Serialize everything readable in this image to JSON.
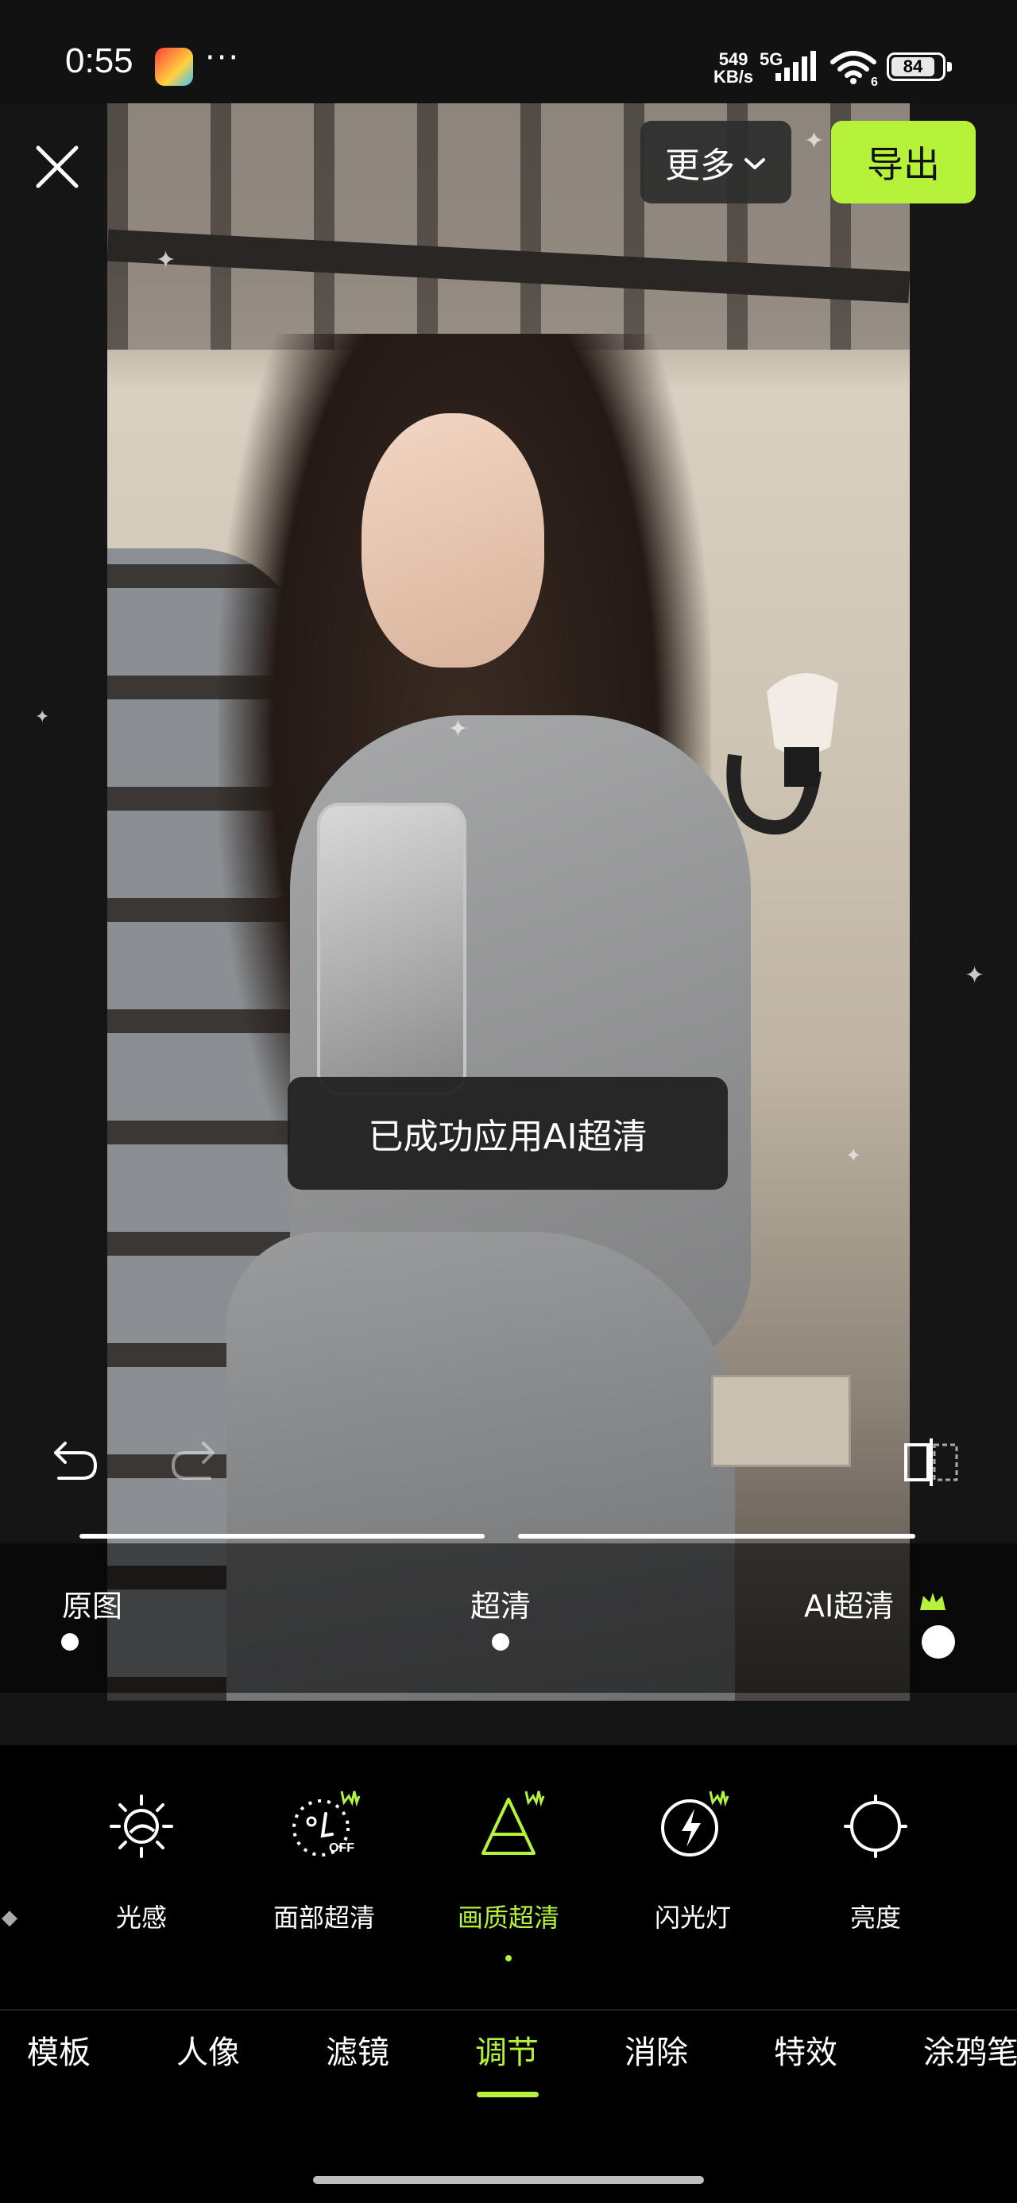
{
  "status_bar": {
    "time": "0:55",
    "overflow": "···",
    "net_speed_value": "549",
    "net_speed_unit": "KB/s",
    "network": "5G",
    "wifi_badge": "6",
    "battery": "84"
  },
  "top_bar": {
    "more_label": "更多",
    "export_label": "导出"
  },
  "toast": "已成功应用AI超清",
  "slider": {
    "labels": [
      "原图",
      "超清",
      "AI超清"
    ],
    "selected": "AI超清",
    "selected_index": 2
  },
  "tools": [
    {
      "label": "光感",
      "icon": "light-sense-icon",
      "vip": false
    },
    {
      "label": "面部超清",
      "icon": "face-hd-icon",
      "vip": true,
      "badge": "OFF"
    },
    {
      "label": "画质超清",
      "icon": "quality-hd-icon",
      "vip": true,
      "active": true
    },
    {
      "label": "闪光灯",
      "icon": "flash-icon",
      "vip": true
    },
    {
      "label": "亮度",
      "icon": "brightness-icon",
      "vip": false
    }
  ],
  "bottom_tabs": [
    "模板",
    "人像",
    "滤镜",
    "调节",
    "消除",
    "特效",
    "涂鸦笔"
  ],
  "active_tab": "调节",
  "colors": {
    "accent": "#b7f23b",
    "background": "#000000",
    "panel": "#151515"
  }
}
